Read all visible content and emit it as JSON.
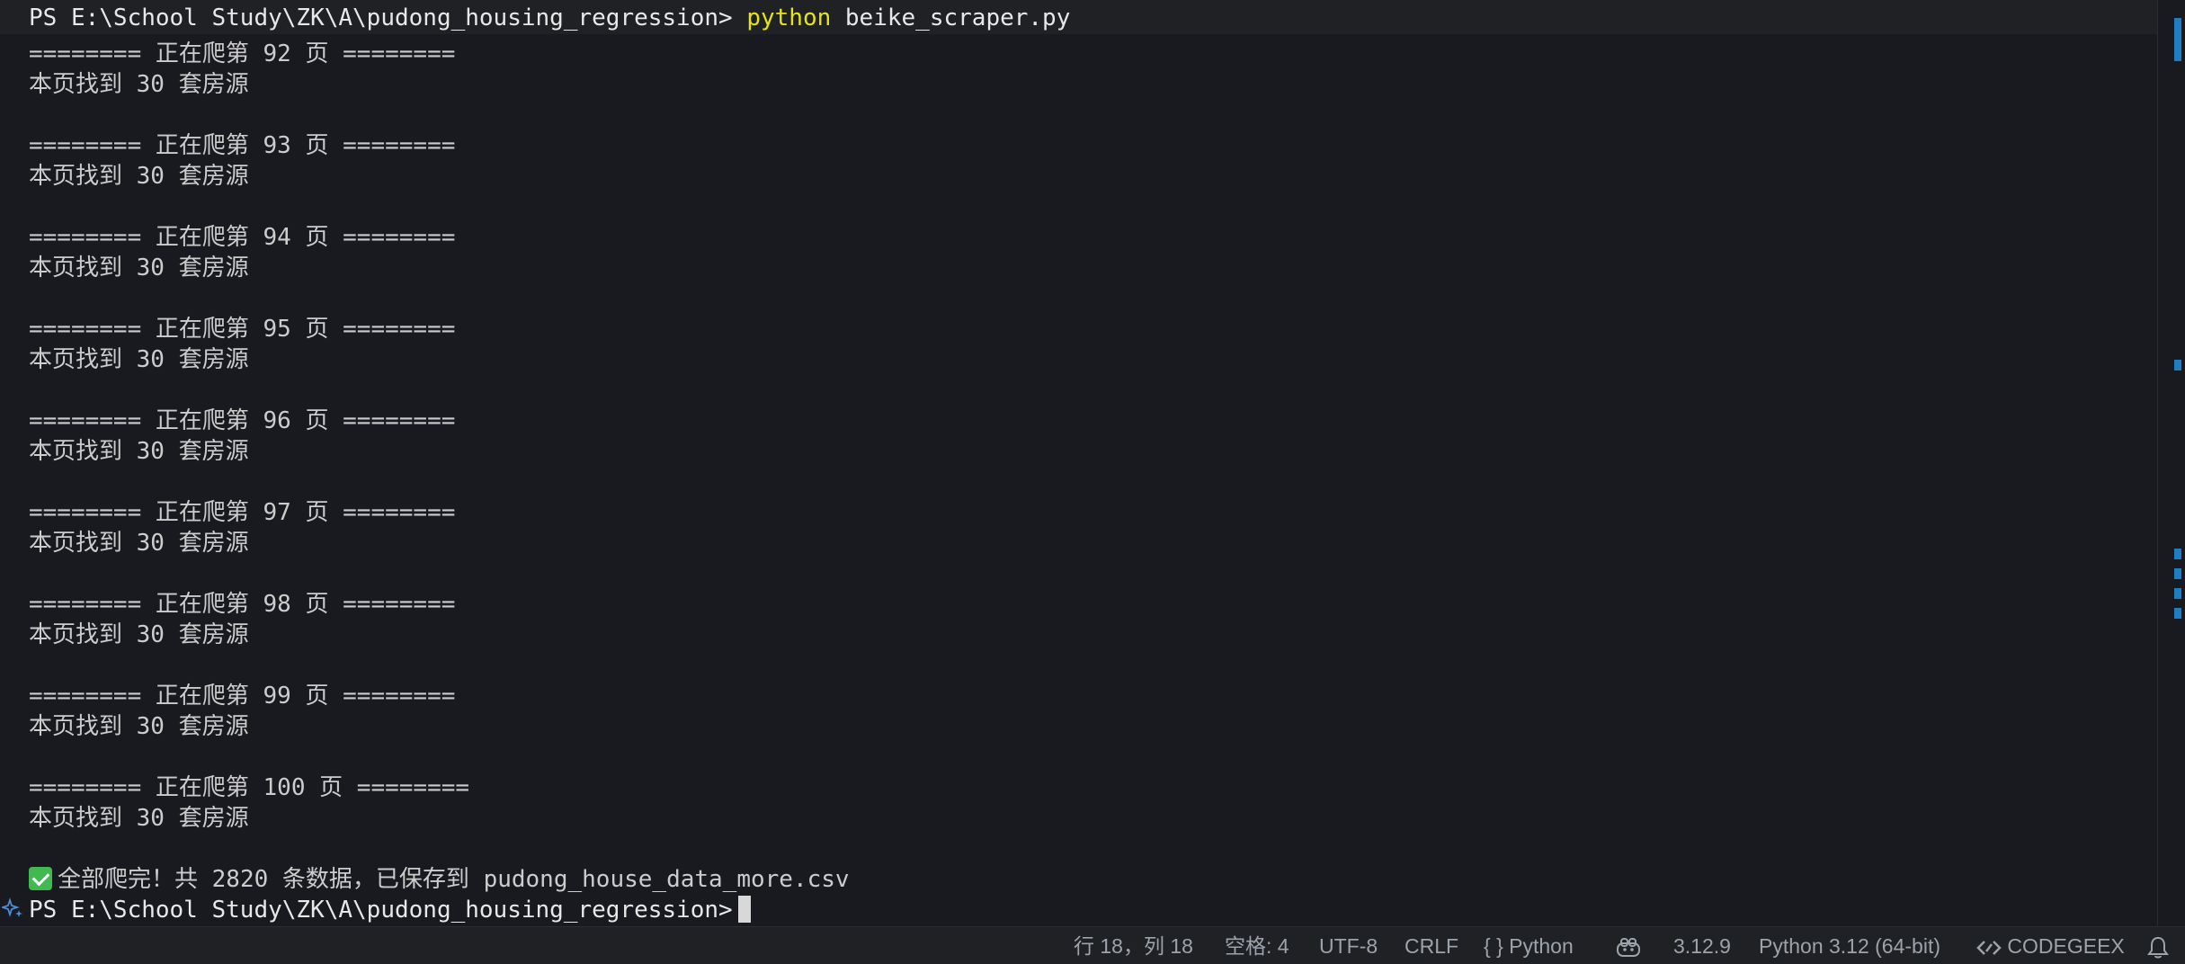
{
  "terminal": {
    "prompt": "PS E:\\School Study\\ZK\\A\\pudong_housing_regression>",
    "command_keyword": "python",
    "command_arg": "beike_scraper.py",
    "pages": [
      {
        "header": "======== 正在爬第 92 页 ========",
        "result": "本页找到 30 套房源"
      },
      {
        "header": "======== 正在爬第 93 页 ========",
        "result": "本页找到 30 套房源"
      },
      {
        "header": "======== 正在爬第 94 页 ========",
        "result": "本页找到 30 套房源"
      },
      {
        "header": "======== 正在爬第 95 页 ========",
        "result": "本页找到 30 套房源"
      },
      {
        "header": "======== 正在爬第 96 页 ========",
        "result": "本页找到 30 套房源"
      },
      {
        "header": "======== 正在爬第 97 页 ========",
        "result": "本页找到 30 套房源"
      },
      {
        "header": "======== 正在爬第 98 页 ========",
        "result": "本页找到 30 套房源"
      },
      {
        "header": "======== 正在爬第 99 页 ========",
        "result": "本页找到 30 套房源"
      },
      {
        "header": "======== 正在爬第 100 页 ========",
        "result": "本页找到 30 套房源"
      }
    ],
    "final_message": "全部爬完！共 2820 条数据，已保存到 pudong_house_data_more.csv",
    "final_prompt": "PS E:\\School Study\\ZK\\A\\pudong_housing_regression>",
    "icons": {
      "success": "check-mark-icon",
      "sparkle": "sparkle-icon"
    }
  },
  "statusbar": {
    "position": "行 18，列 18",
    "indent": "空格: 4",
    "encoding": "UTF-8",
    "eol": "CRLF",
    "language_icon": "{ }",
    "language": "Python",
    "copilot_icon": "copilot-icon",
    "python_version": "3.12.9",
    "interpreter": "Python 3.12 (64-bit)",
    "codegeex_icon": "codegeex-icon",
    "codegeex": "CODEGEEX",
    "bell_icon": "bell-icon"
  },
  "colors": {
    "background": "#181a1f",
    "text": "#cccccc",
    "command_keyword": "#e5e510",
    "success": "#3fb950",
    "ruler_mark": "#1f7ec2",
    "statusbar_text": "#9da3ab"
  }
}
